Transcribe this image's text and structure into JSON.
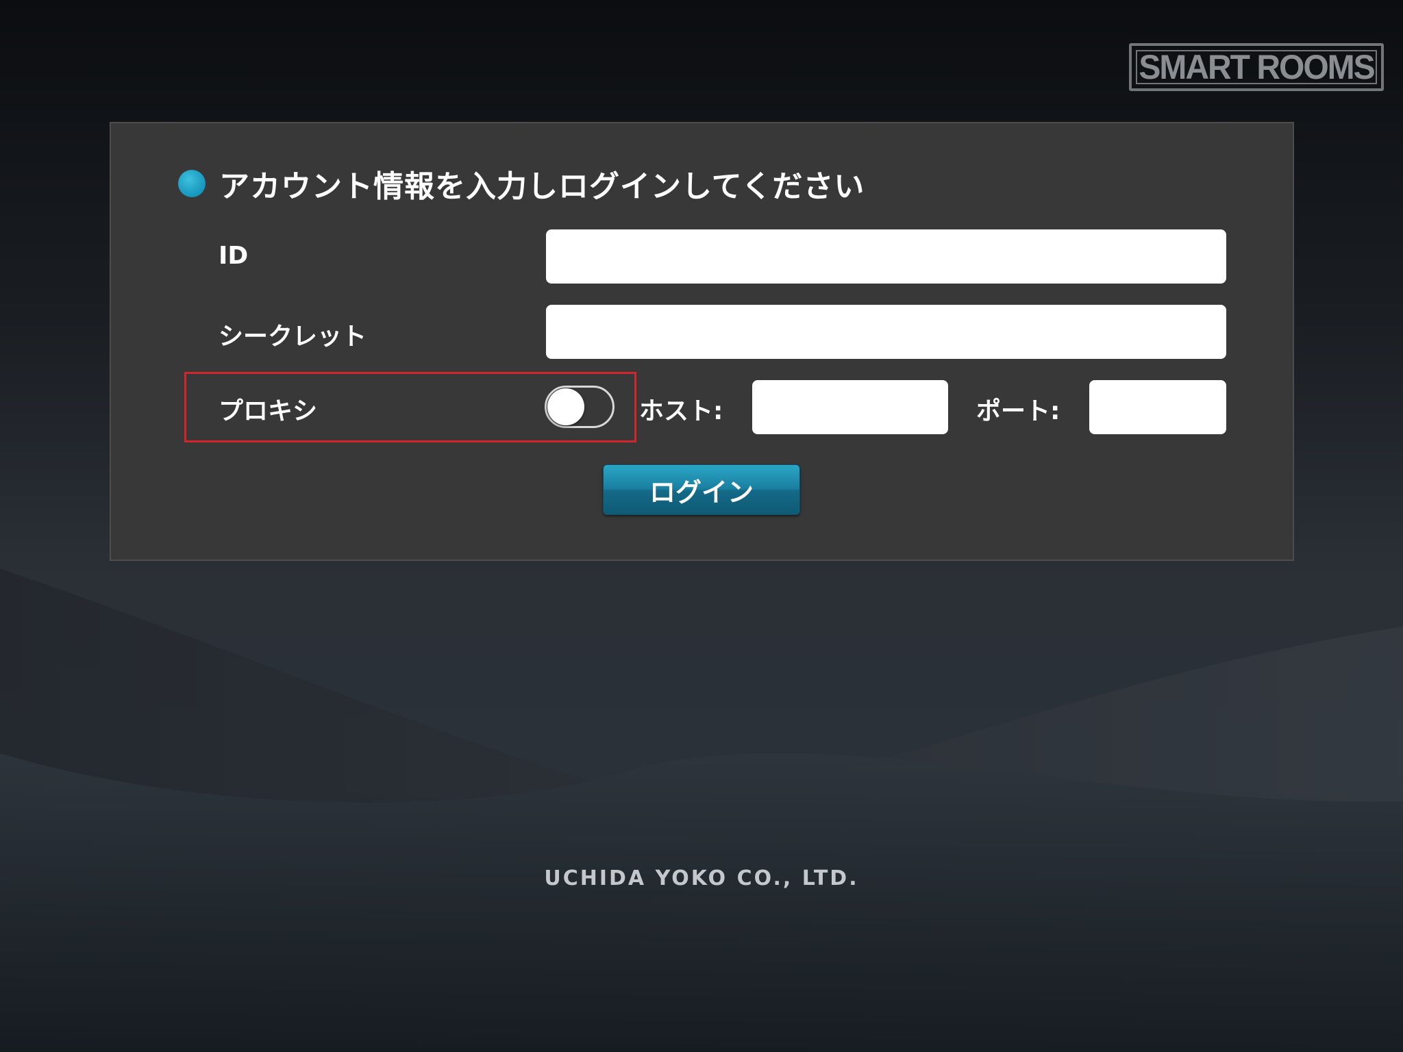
{
  "brand": {
    "logo_text": "SMART ROOMS",
    "company": "UCHIDA YOKO CO., LTD."
  },
  "login_form": {
    "heading": "アカウント情報を入力しログインしてください",
    "id_label": "ID",
    "id_value": "",
    "secret_label": "シークレット",
    "secret_value": "",
    "proxy_label": "プロキシ",
    "proxy_enabled": false,
    "host_label": "ホスト:",
    "host_value": "",
    "port_label": "ポート:",
    "port_value": "",
    "login_button": "ログイン"
  },
  "colors": {
    "accent": "#1a9fc4",
    "panel": "#383838",
    "highlight": "#d3252c"
  }
}
